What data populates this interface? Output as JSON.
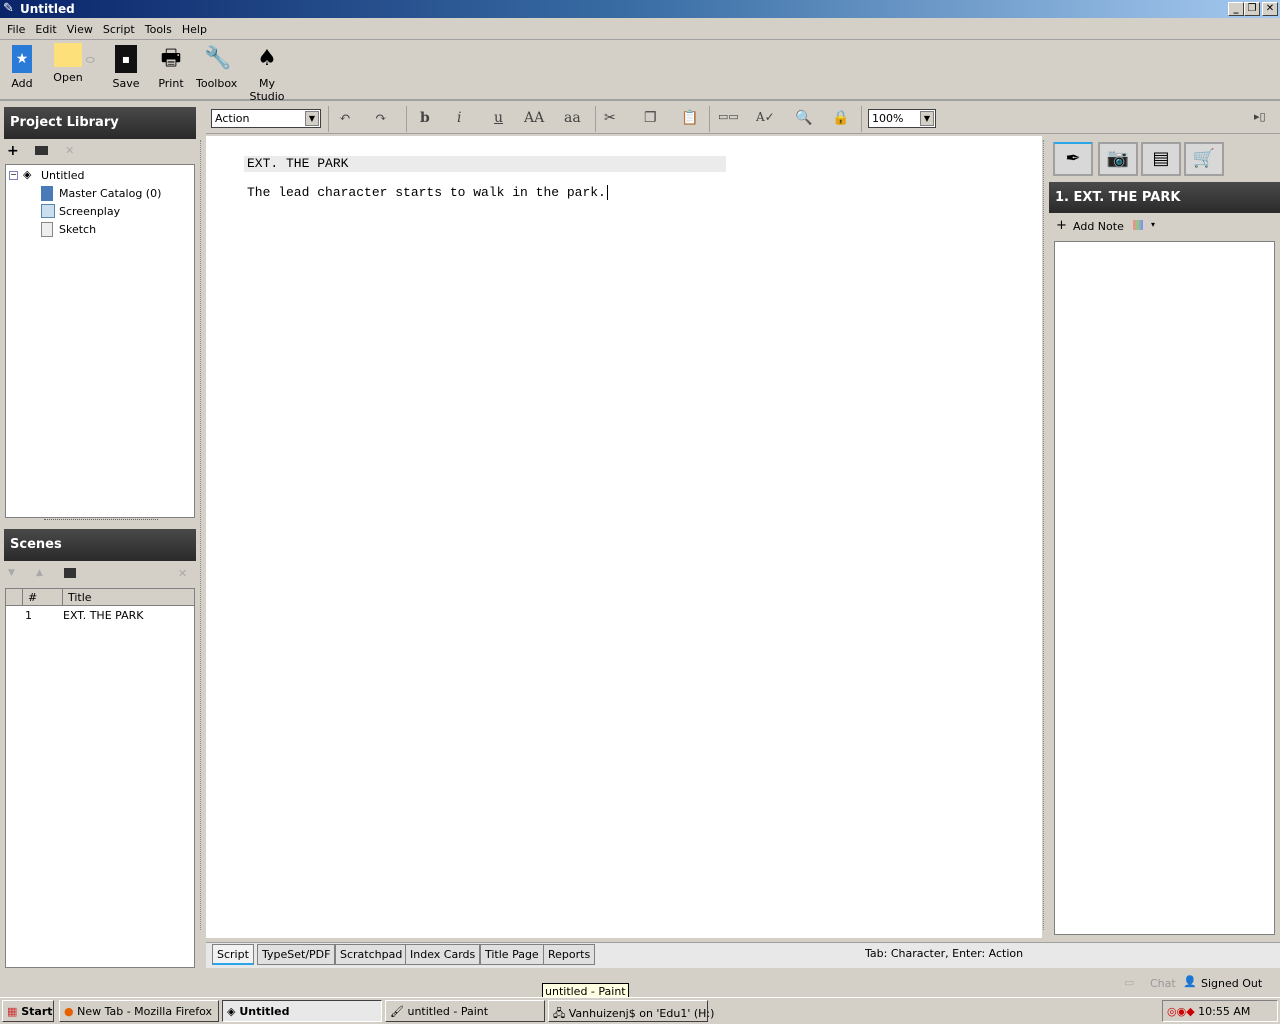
{
  "window": {
    "title": "Untitled"
  },
  "menu": [
    "File",
    "Edit",
    "View",
    "Script",
    "Tools",
    "Help"
  ],
  "toolbar": {
    "add": "Add",
    "open": "Open",
    "save": "Save",
    "print": "Print",
    "toolbox": "Toolbox",
    "studio": "My Studio"
  },
  "library": {
    "title": "Project Library",
    "root": "Untitled",
    "items": [
      "Master Catalog (0)",
      "Screenplay",
      "Sketch"
    ]
  },
  "scenes": {
    "title": "Scenes",
    "col_num": "#",
    "col_title": "Title",
    "rows": [
      {
        "num": "1",
        "title": "EXT. THE PARK"
      }
    ]
  },
  "format": {
    "element": "Action",
    "bold": "b",
    "italic": "i",
    "underline": "u",
    "upper": "AA",
    "lower": "aa",
    "zoom": "100%"
  },
  "script": {
    "heading": "EXT. THE PARK",
    "action": "The lead character starts to walk in the park."
  },
  "right": {
    "scene_title": "1. EXT. THE PARK",
    "add_note": "Add Note"
  },
  "tabs": [
    "Script",
    "TypeSet/PDF",
    "Scratchpad",
    "Index Cards",
    "Title Page",
    "Reports"
  ],
  "status": {
    "hint": "Tab: Character, Enter: Action",
    "chat": "Chat",
    "signed": "Signed Out"
  },
  "tooltip": "untitled - Paint",
  "taskbar": {
    "start": "Start",
    "items": [
      "New Tab - Mozilla Firefox",
      "Untitled",
      "untitled - Paint",
      "Vanhuizenj$ on 'Edu1' (H:)"
    ],
    "clock": "10:55 AM"
  },
  "colors": {
    "accent": "#2aa6e8",
    "panel_head": "#333333"
  }
}
